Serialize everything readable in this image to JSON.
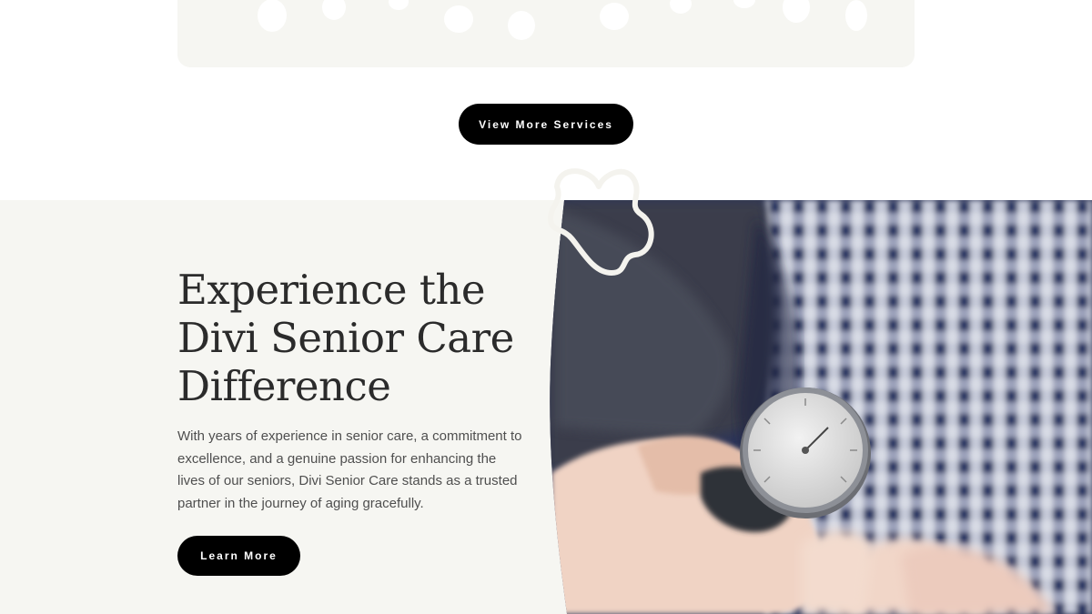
{
  "services": {
    "view_more_label": "View More Services"
  },
  "difference_section": {
    "heading": "Experience the Divi Senior Care Difference",
    "body": "With years of experience in senior care, a commitment to excellence, and a genuine passion for enhancing the lives of our seniors, Divi Senior Care stands as a trusted partner in the journey of aging gracefully.",
    "learn_more_label": "Learn More",
    "image_subject": "blood-pressure-gauge-photo"
  },
  "colors": {
    "button_bg": "#000000",
    "button_text": "#ffffff",
    "section_bg": "#f6f6f2",
    "heading_text": "#2b2b2b",
    "body_text": "#4f4f4f"
  }
}
